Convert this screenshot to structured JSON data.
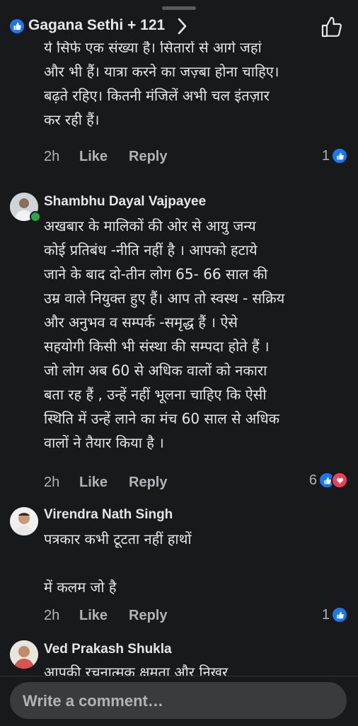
{
  "header": {
    "title": "Gagana Sethi + 121",
    "like_icon": "like-badge-icon",
    "chevron_icon": "chevron-right-icon",
    "action_icon": "thumbs-up-outline-icon"
  },
  "comments": [
    {
      "author": "",
      "text": "ये सिर्फ एक संख्या है। सितारों से आगे जहां\nऔर भी हैं। यात्रा करने का जज़्बा होना चाहिए।\nबढ़ते रहिए। कितनी मंजिलें अभी चल इंतज़ार\nकर रही हैं।",
      "time": "2h",
      "like_label": "Like",
      "reply_label": "Reply",
      "reaction_count": "1"
    },
    {
      "author": "Shambhu Dayal Vajpayee",
      "text": "अखबार के मालिकों  की ओर से  आयु जन्य\nकोई प्रतिबंध -नीति नहीं है । आपको हटाये\nजाने के बाद दो-तीन लोग 65- 66 साल की\nउम्र वाले नियुक्त हुए हैं। आप तो स्वस्थ - सक्रिय\nऔर अनुभव व सम्पर्क -समृद्ध हैं । ऐसे\nसहयोगी किसी भी संस्था की सम्पदा होते हैं ।\nजो लोग अब 60 से अधिक वालों को नकारा\nबता रह हैं , उन्हें नहीं भूलना चाहिए कि ऐसी\nस्थिति में उन्हें लाने का मंच 60 साल से अधिक\nवालों ने तैयार किया है ।",
      "time": "2h",
      "like_label": "Like",
      "reply_label": "Reply",
      "reaction_count": "6"
    },
    {
      "author": "Virendra Nath Singh",
      "text": "पत्रकार कभी टूटता नहीं हाथों\n\n में कलम जो है",
      "time": "2h",
      "like_label": "Like",
      "reply_label": "Reply",
      "reaction_count": "1"
    },
    {
      "author": "Ved Prakash Shukla",
      "text": "आपकी रचनात्मक क्षमता और निखर"
    }
  ],
  "composer": {
    "placeholder": "Write a comment…"
  },
  "colors": {
    "background": "#18191a",
    "text": "#e4e6eb",
    "secondary": "#b0b3b8",
    "like_blue": "#1877f2",
    "love_red": "#f33e58",
    "online_green": "#31a24c"
  }
}
